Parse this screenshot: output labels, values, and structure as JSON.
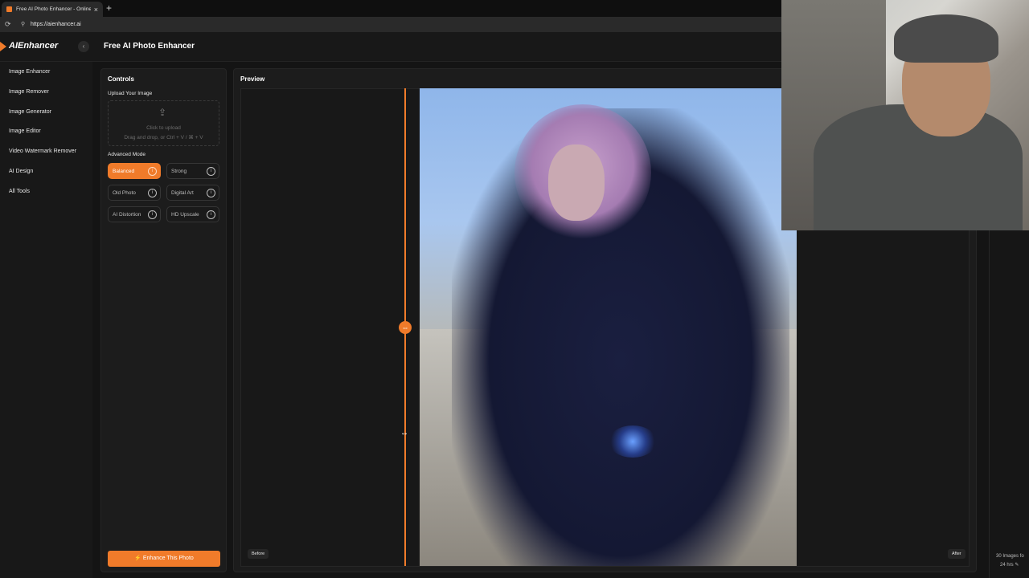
{
  "browser": {
    "tab_title": "Free AI Photo Enhancer - Online A",
    "tab_close": "×",
    "new_tab": "+",
    "url": "https://aienhancer.ai"
  },
  "app": {
    "logo": "AIEnhancer",
    "collapse_glyph": "‹",
    "title": "Free AI Photo Enhancer"
  },
  "sidebar": {
    "items": [
      {
        "label": "Image Enhancer"
      },
      {
        "label": "Image Remover"
      },
      {
        "label": "Image Generator"
      },
      {
        "label": "Image Editor"
      },
      {
        "label": "Video Watermark Remover"
      },
      {
        "label": "AI Design"
      },
      {
        "label": "All Tools"
      }
    ]
  },
  "controls": {
    "title": "Controls",
    "upload_label": "Upload Your Image",
    "dropzone_line1": "Click to upload",
    "dropzone_line2": "Drag and drop, or Ctrl + V / ⌘ + V",
    "advanced_label": "Advanced Mode",
    "modes": [
      {
        "label": "Balanced",
        "active": true
      },
      {
        "label": "Strong",
        "active": false
      },
      {
        "label": "Old Photo",
        "active": false
      },
      {
        "label": "Digital Art",
        "active": false
      },
      {
        "label": "AI Distortion",
        "active": false
      },
      {
        "label": "HD Upscale",
        "active": false
      }
    ],
    "info_glyph": "i",
    "enhance_button": "Enhance This Photo",
    "enhance_icon": "magic-wand-icon"
  },
  "preview": {
    "title": "Preview",
    "before_tag": "Before",
    "after_tag": "After",
    "slider_glyph": "⇔",
    "cursor_glyph": "↔"
  },
  "right_panel": {
    "line1": "30 Images fo",
    "line2": "24 hrs ✎"
  },
  "colors": {
    "accent": "#f07b2a",
    "background": "#141414",
    "panel": "#1c1c1c"
  }
}
